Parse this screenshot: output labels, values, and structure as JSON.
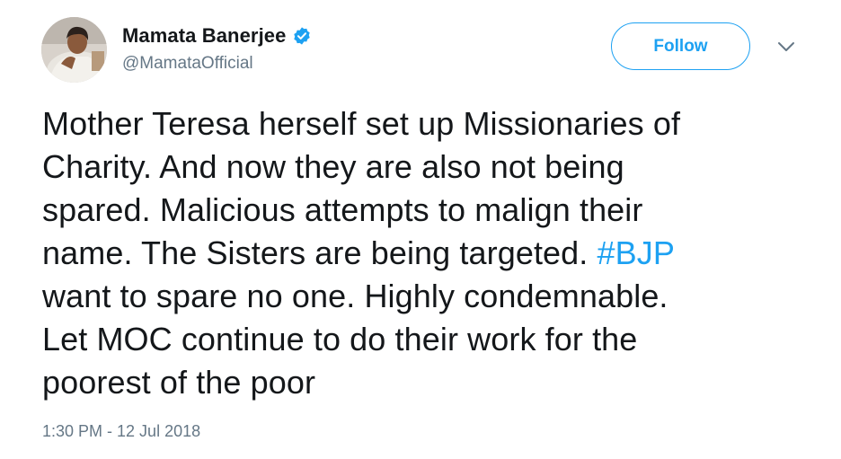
{
  "user": {
    "display_name": "Mamata Banerjee",
    "handle": "@MamataOfficial",
    "verified": true
  },
  "actions": {
    "follow_label": "Follow"
  },
  "tweet": {
    "lines": [
      {
        "text": "Mother Teresa herself set up Missionaries of"
      },
      {
        "text": "Charity. And now they are also not being"
      },
      {
        "text": "spared. Malicious attempts to malign their"
      },
      {
        "text": "name. The Sisters are being targeted. ",
        "hashtag": "#BJP"
      },
      {
        "text": "want to spare no one. Highly condemnable."
      },
      {
        "text": "Let MOC continue to do their work for the"
      },
      {
        "text": "poorest of the poor"
      }
    ],
    "timestamp": "1:30 PM - 12 Jul 2018"
  },
  "colors": {
    "accent": "#1da1f2",
    "text_primary": "#14171a",
    "text_secondary": "#657786"
  },
  "icons": {
    "verified": "verified-badge-icon",
    "menu": "chevron-down-icon"
  }
}
